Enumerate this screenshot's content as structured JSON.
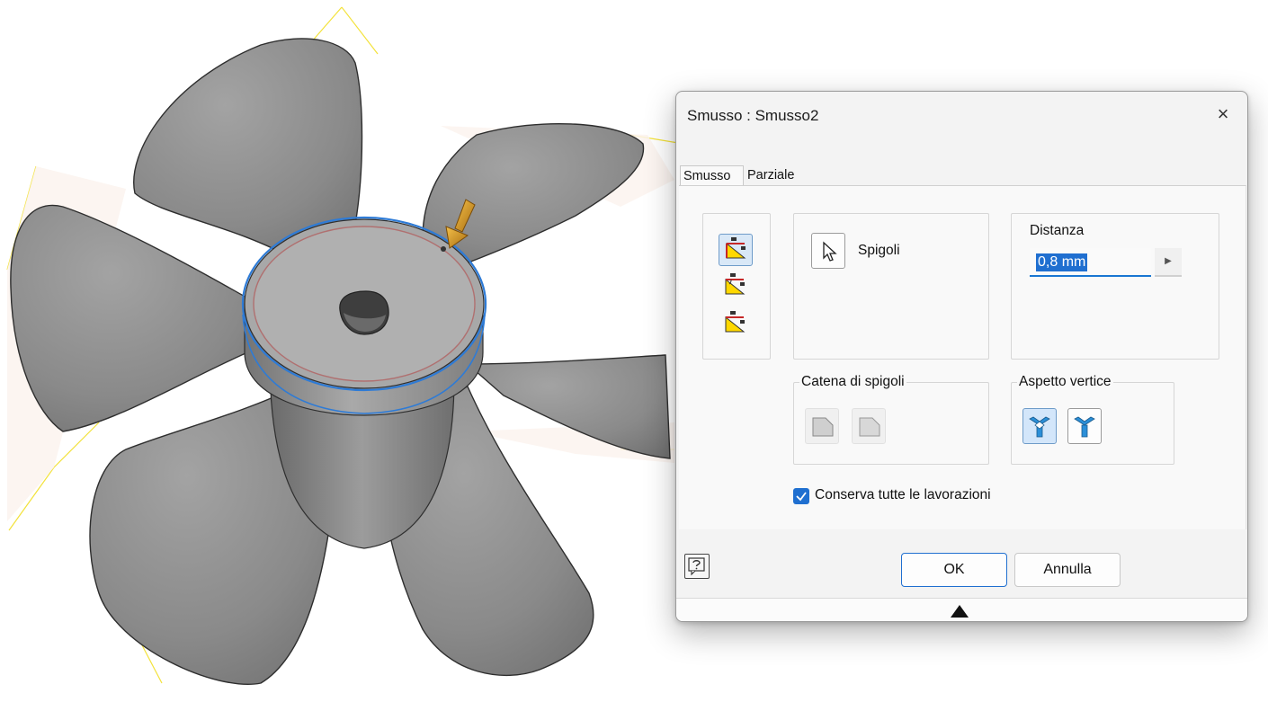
{
  "dialog": {
    "title": "Smusso : Smusso2",
    "close_symbol": "×",
    "tabs": [
      {
        "label": "Smusso",
        "active": true
      },
      {
        "label": "Parziale",
        "active": false
      }
    ],
    "method_buttons": [
      {
        "icon": "chamfer-distance-icon",
        "selected": true
      },
      {
        "icon": "chamfer-distance-angle-icon",
        "selected": false
      },
      {
        "icon": "chamfer-two-distances-icon",
        "selected": false
      }
    ],
    "edges": {
      "label": "Spigoli",
      "icon": "select-cursor-icon"
    },
    "distance": {
      "label": "Distanza",
      "value": "0,8 mm",
      "arrow_symbol": "▶"
    },
    "edge_chain": {
      "label": "Catena di spigoli",
      "buttons": [
        {
          "icon": "edge-chain-all-icon"
        },
        {
          "icon": "edge-chain-single-icon"
        }
      ]
    },
    "setback": {
      "label": "Aspetto vertice",
      "buttons": [
        {
          "icon": "vertex-setback-icon",
          "selected": true
        },
        {
          "icon": "vertex-no-setback-icon",
          "selected": false
        }
      ]
    },
    "preserve_all": {
      "label": "Conserva tutte le lavorazioni",
      "checked": true
    },
    "buttons": {
      "ok": "OK",
      "cancel": "Annulla"
    },
    "help_icon": "help-icon",
    "grip_icon": "triangle-up-icon"
  },
  "viewport": {
    "model": "fan-blade-part",
    "highlight_color": "#2e7bd6"
  },
  "colors": {
    "accent": "#1f6fd0",
    "selection": "#d9e8f7",
    "preview": "#d4a020"
  }
}
